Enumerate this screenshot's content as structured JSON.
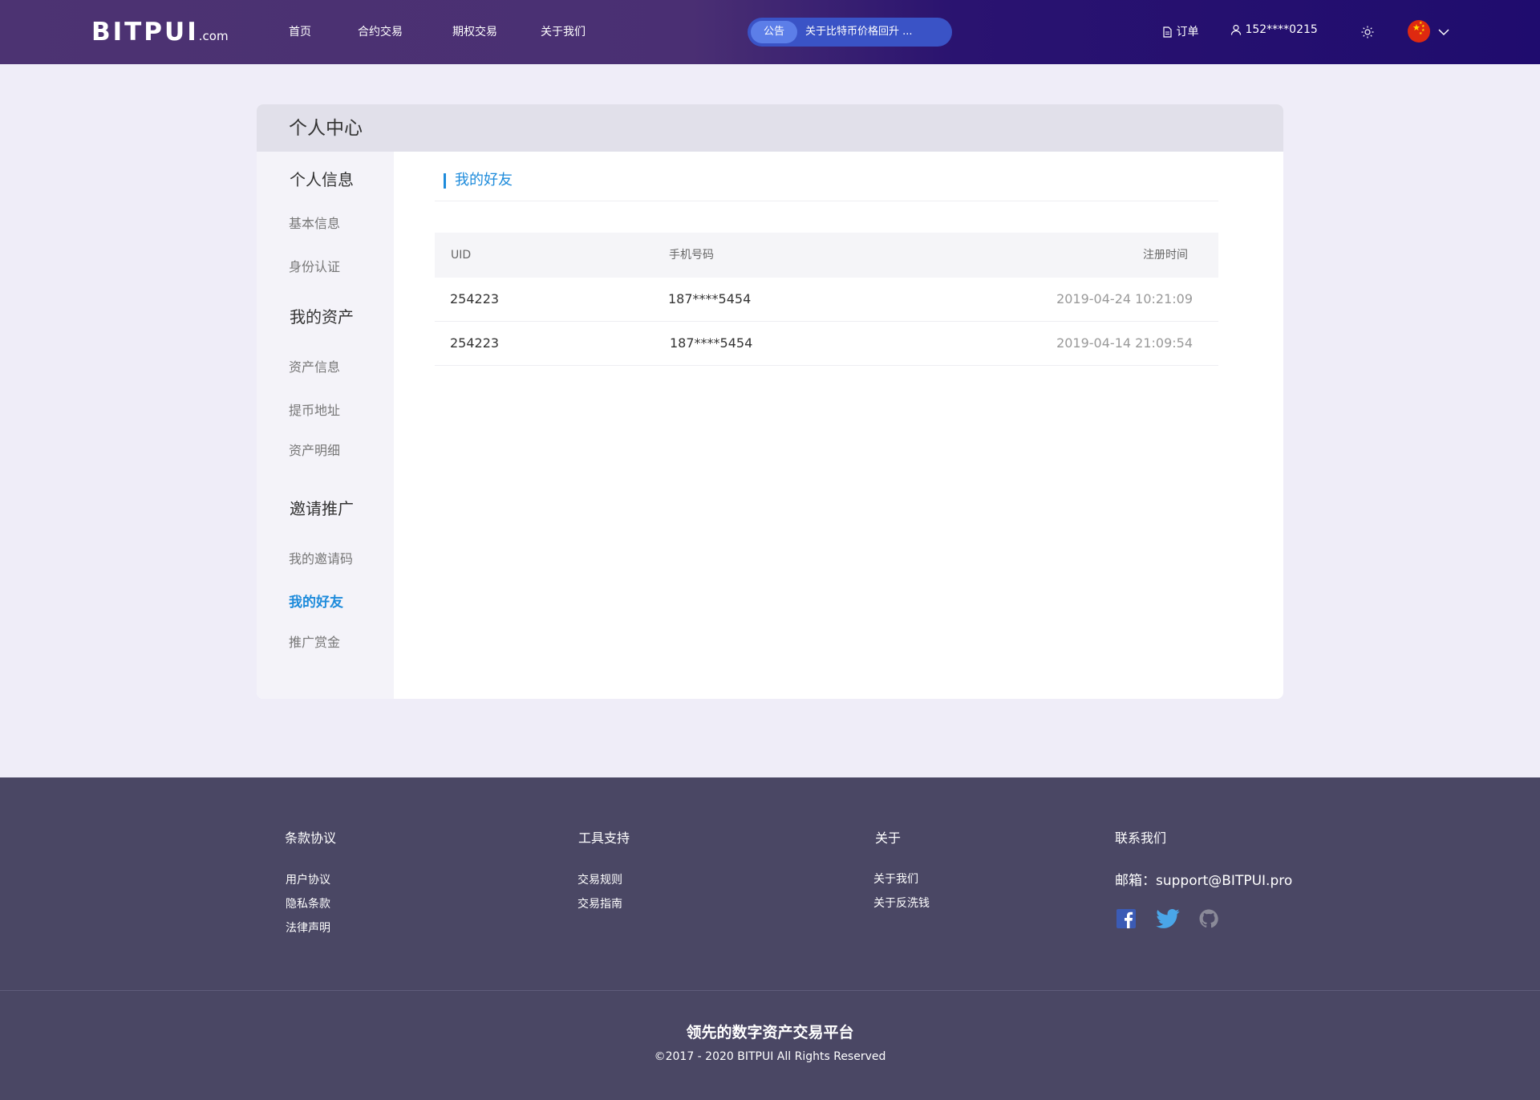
{
  "header": {
    "logo_text": "BITPUI",
    "logo_suffix": ".com",
    "nav": [
      {
        "label": "首页"
      },
      {
        "label": "合约交易"
      },
      {
        "label": "期权交易"
      },
      {
        "label": "关于我们"
      }
    ],
    "notice": {
      "badge": "公告",
      "text": "关于比特币价格回升 ..."
    },
    "orders_label": "订单",
    "user_label": "152****0215",
    "theme_icon": "sun-icon",
    "language_icon": "china-flag-icon"
  },
  "page": {
    "title": "个人中心",
    "sidebar": {
      "groups": [
        {
          "label": "个人信息",
          "items": [
            {
              "label": "基本信息"
            },
            {
              "label": "身份认证"
            }
          ]
        },
        {
          "label": "我的资产",
          "items": [
            {
              "label": "资产信息"
            },
            {
              "label": "提币地址"
            },
            {
              "label": "资产明细"
            }
          ]
        },
        {
          "label": "邀请推广",
          "items": [
            {
              "label": "我的邀请码"
            },
            {
              "label": "我的好友"
            },
            {
              "label": "推广赏金"
            }
          ]
        }
      ],
      "active_item": "我的好友"
    },
    "section_title": "我的好友",
    "table": {
      "columns": [
        "UID",
        "手机号码",
        "注册时间"
      ],
      "rows": [
        [
          "254223",
          "187****5454",
          "2019-04-24 10:21:09"
        ],
        [
          "254223",
          "187****5454",
          "2019-04-14 21:09:54"
        ]
      ]
    }
  },
  "footer": {
    "columns": [
      {
        "title": "条款协议",
        "links": [
          "用户协议",
          "隐私条款",
          "法律声明"
        ]
      },
      {
        "title": "工具支持",
        "links": [
          "交易规则",
          "交易指南"
        ]
      },
      {
        "title": "关于",
        "links": [
          "关于我们",
          "关于反洗钱"
        ]
      },
      {
        "title": "联系我们",
        "links": []
      }
    ],
    "email": "邮箱：support@BITPUI.pro",
    "social_icons": [
      "facebook-icon",
      "twitter-icon",
      "github-icon"
    ],
    "slogan": "领先的数字资产交易平台",
    "copyright": "©2017 - 2020 BITPUI All Rights Reserved"
  },
  "colors": {
    "accent": "#1d8bdb",
    "header_gradient_start": "#4c3372",
    "header_gradient_end": "#1f0c6e",
    "footer_bg": "#4a4764",
    "page_bg": "#efedf8"
  }
}
